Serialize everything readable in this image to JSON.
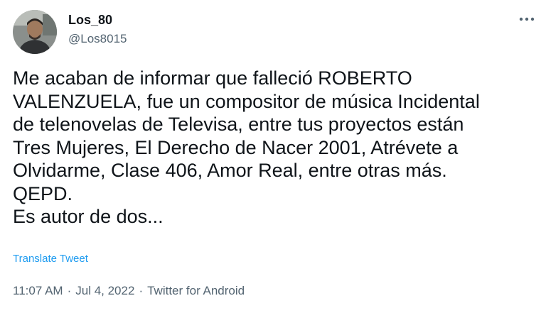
{
  "author": {
    "display_name": "Los_80",
    "handle": "@Los8015",
    "avatar_icon": "profile-photo"
  },
  "menu": {
    "icon": "more-horizontal-icon",
    "glyph": "•••"
  },
  "tweet": {
    "lines": [
      "Me acaban de informar que falleció ROBERTO",
      "VALENZUELA, fue un compositor de música Incidental",
      "de telenovelas de Televisa, entre tus proyectos están",
      "Tres Mujeres, El Derecho de Nacer 2001, Atrévete a",
      "Olvidarme, Clase 406, Amor Real, entre otras más.",
      "QEPD.",
      "Es autor de dos..."
    ]
  },
  "translate_label": "Translate Tweet",
  "metadata": {
    "time": "11:07 AM",
    "separator": "·",
    "date": "Jul 4, 2022",
    "source": "Twitter for Android"
  },
  "colors": {
    "text_primary": "#0f1419",
    "text_secondary": "#536471",
    "link": "#1d9bf0"
  }
}
